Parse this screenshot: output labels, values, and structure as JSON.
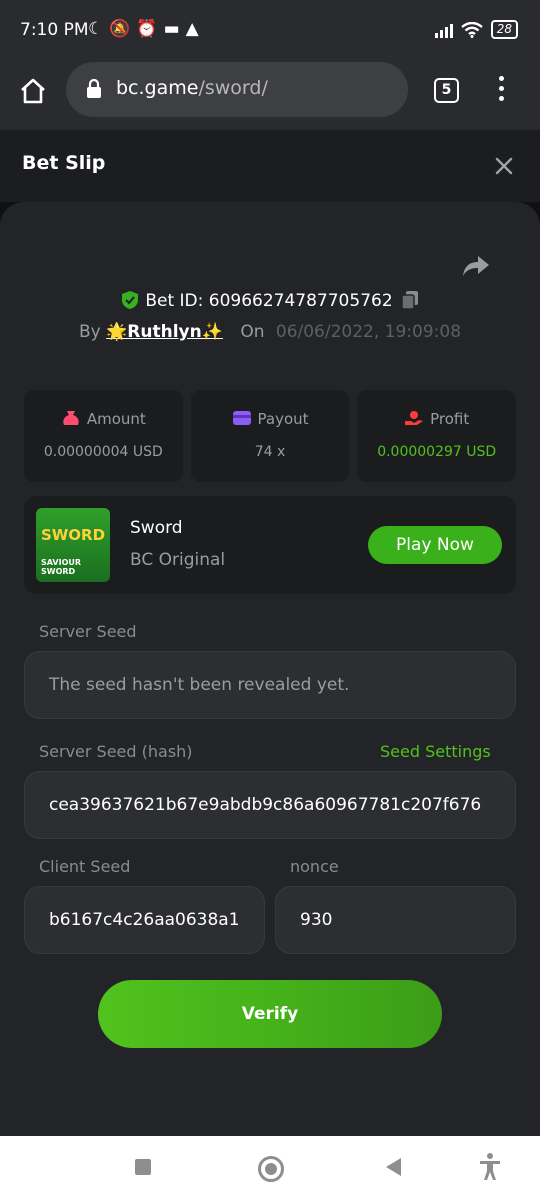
{
  "status_bar": {
    "time": "7:10 PM",
    "icons": [
      "moon-icon",
      "bell-off-icon",
      "alarm-icon",
      "folder-icon",
      "warning-icon"
    ],
    "battery": "28"
  },
  "browser": {
    "url_host": "bc.game",
    "url_path": "/sword/",
    "tab_count": "5"
  },
  "header": {
    "title": "Bet Slip"
  },
  "bet": {
    "id_text": "Bet ID: 60966274787705762",
    "by_label": "By",
    "user": "🌟Ruthlyn✨",
    "on_label": "On",
    "date": "06/06/2022, 19:09:08"
  },
  "stats": [
    {
      "label": "Amount",
      "value": "0.00000004 USD",
      "icon": "money-bag-icon",
      "color": "#ff4b6e"
    },
    {
      "label": "Payout",
      "value": "74 x",
      "icon": "wallet-icon",
      "color": "#8b5cf6"
    },
    {
      "label": "Profit",
      "value": "0.00000297 USD",
      "icon": "hand-coin-icon",
      "color": "#ff3b3b"
    }
  ],
  "game": {
    "thumb_title": "SWORD",
    "thumb_sub": "SAVIOUR SWORD",
    "name": "Sword",
    "type": "BC Original",
    "play_label": "Play Now"
  },
  "seeds": {
    "server_seed_label": "Server Seed",
    "server_seed_placeholder": "The seed hasn't been revealed yet.",
    "server_hash_label": "Server Seed (hash)",
    "seed_settings_label": "Seed Settings",
    "server_hash_value": "cea39637621b67e9abdb9c86a60967781c207f676",
    "client_seed_label": "Client Seed",
    "client_seed_value": "b6167c4c26aa0638a1",
    "nonce_label": "nonce",
    "nonce_value": "930"
  },
  "verify_label": "Verify",
  "colors": {
    "accent_green": "#51c21d",
    "panel_bg": "#232427",
    "field_bg": "#2d2e32"
  }
}
